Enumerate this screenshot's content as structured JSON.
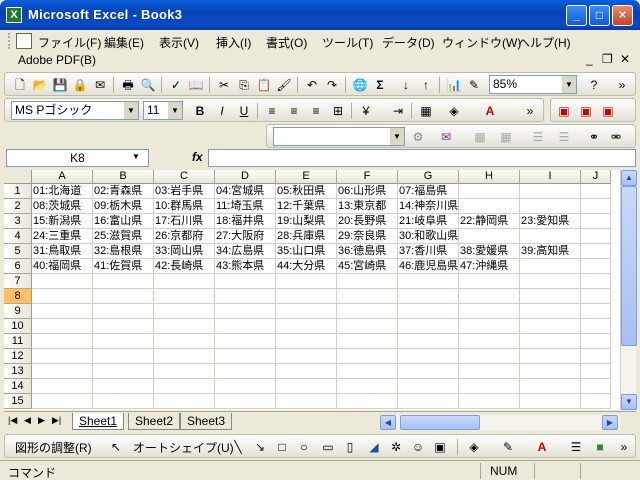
{
  "window": {
    "title": "Microsoft Excel - Book3",
    "app_icon": "X"
  },
  "menu": {
    "items": [
      "ファイル(F)",
      "編集(E)",
      "表示(V)",
      "挿入(I)",
      "書式(O)",
      "ツール(T)",
      "データ(D)",
      "ウィンドウ(W)",
      "ヘルプ(H)"
    ],
    "adobe": "Adobe PDF(B)"
  },
  "toolbar": {
    "zoom": "85%"
  },
  "format_toolbar": {
    "font": "MS Pゴシック",
    "size": "11"
  },
  "formula_bar": {
    "name_box": "K8",
    "fx_label": "fx",
    "content": ""
  },
  "sheet": {
    "columns": [
      "A",
      "B",
      "C",
      "D",
      "E",
      "F",
      "G",
      "H",
      "I",
      "J"
    ],
    "rows": [
      "1",
      "2",
      "3",
      "4",
      "5",
      "6",
      "7",
      "8",
      "9",
      "10",
      "11",
      "12",
      "13",
      "14",
      "15"
    ],
    "selected_row": "8",
    "cells": [
      [
        "01:北海道",
        "02:青森県",
        "03:岩手県",
        "04:宮城県",
        "05:秋田県",
        "06:山形県",
        "07:福島県",
        "",
        "",
        ""
      ],
      [
        "08:茨城県",
        "09:栃木県",
        "10:群馬県",
        "11:埼玉県",
        "12:千葉県",
        "13:東京都",
        "14:神奈川県",
        "",
        "",
        ""
      ],
      [
        "15:新潟県",
        "16:富山県",
        "17:石川県",
        "18:福井県",
        "19:山梨県",
        "20:長野県",
        "21:岐阜県",
        "22:静岡県",
        "23:愛知県",
        ""
      ],
      [
        "24:三重県",
        "25:滋賀県",
        "26:京都府",
        "27:大阪府",
        "28:兵庫県",
        "29:奈良県",
        "30:和歌山県",
        "",
        "",
        ""
      ],
      [
        "31:鳥取県",
        "32:島根県",
        "33:岡山県",
        "34:広島県",
        "35:山口県",
        "36:徳島県",
        "37:香川県",
        "38:愛媛県",
        "39:高知県",
        ""
      ],
      [
        "40:福岡県",
        "41:佐賀県",
        "42:長崎県",
        "43:熊本県",
        "44:大分県",
        "45:宮崎県",
        "46:鹿児島県",
        "47:沖縄県",
        "",
        ""
      ]
    ]
  },
  "tabs": [
    "Sheet1",
    "Sheet2",
    "Sheet3"
  ],
  "active_tab": "Sheet1",
  "draw_toolbar": {
    "adjust": "図形の調整(R)",
    "autoshape": "オートシェイプ(U)"
  },
  "status": {
    "text": "コマンド",
    "num": "NUM"
  },
  "colors": {
    "titlebar": "#0a5fd8",
    "selected_row": "#ffc060"
  }
}
